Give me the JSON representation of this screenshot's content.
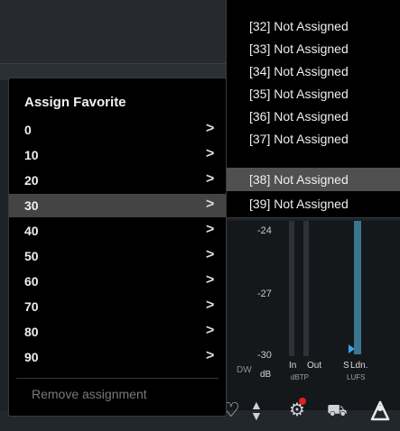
{
  "favorite_menu": {
    "title": "Assign Favorite",
    "items": [
      {
        "label": "0",
        "selected": false
      },
      {
        "label": "10",
        "selected": false
      },
      {
        "label": "20",
        "selected": false
      },
      {
        "label": "30",
        "selected": true
      },
      {
        "label": "40",
        "selected": false
      },
      {
        "label": "50",
        "selected": false
      },
      {
        "label": "60",
        "selected": false
      },
      {
        "label": "70",
        "selected": false
      },
      {
        "label": "80",
        "selected": false
      },
      {
        "label": "90",
        "selected": false
      }
    ],
    "chevron": ">",
    "remove_label": "Remove assignment"
  },
  "slot_submenu": {
    "items": [
      {
        "label": "[32] Not Assigned",
        "selected": false
      },
      {
        "label": "[33] Not Assigned",
        "selected": false
      },
      {
        "label": "[34] Not Assigned",
        "selected": false
      },
      {
        "label": "[35] Not Assigned",
        "selected": false
      },
      {
        "label": "[36] Not Assigned",
        "selected": false
      },
      {
        "label": "[37] Not Assigned",
        "selected": false
      },
      {
        "label": "[38] Not Assigned",
        "selected": true
      },
      {
        "label": "[39] Not Assigned",
        "selected": false
      }
    ]
  },
  "meters": {
    "ticks": [
      "-24",
      "-27",
      "-30"
    ],
    "unit_db": "dB",
    "in_label": "In",
    "out_label": "Out",
    "dbtp_label": "dBTP",
    "s_label": "S",
    "ldn_label": "Ldn.",
    "lufs_label": "LUFS",
    "partial_label": "DW"
  },
  "toolbar": {
    "icons": [
      "heart-icon",
      "up-down-arrows-icon",
      "gear-icon",
      "cart-icon",
      "share-logo-icon"
    ],
    "notification_color": "#e0201a"
  },
  "colors": {
    "menu_bg": "#000000",
    "selected_bg": "#444444",
    "meter_fill": "#3b7690",
    "marker": "#3aa2e6"
  }
}
